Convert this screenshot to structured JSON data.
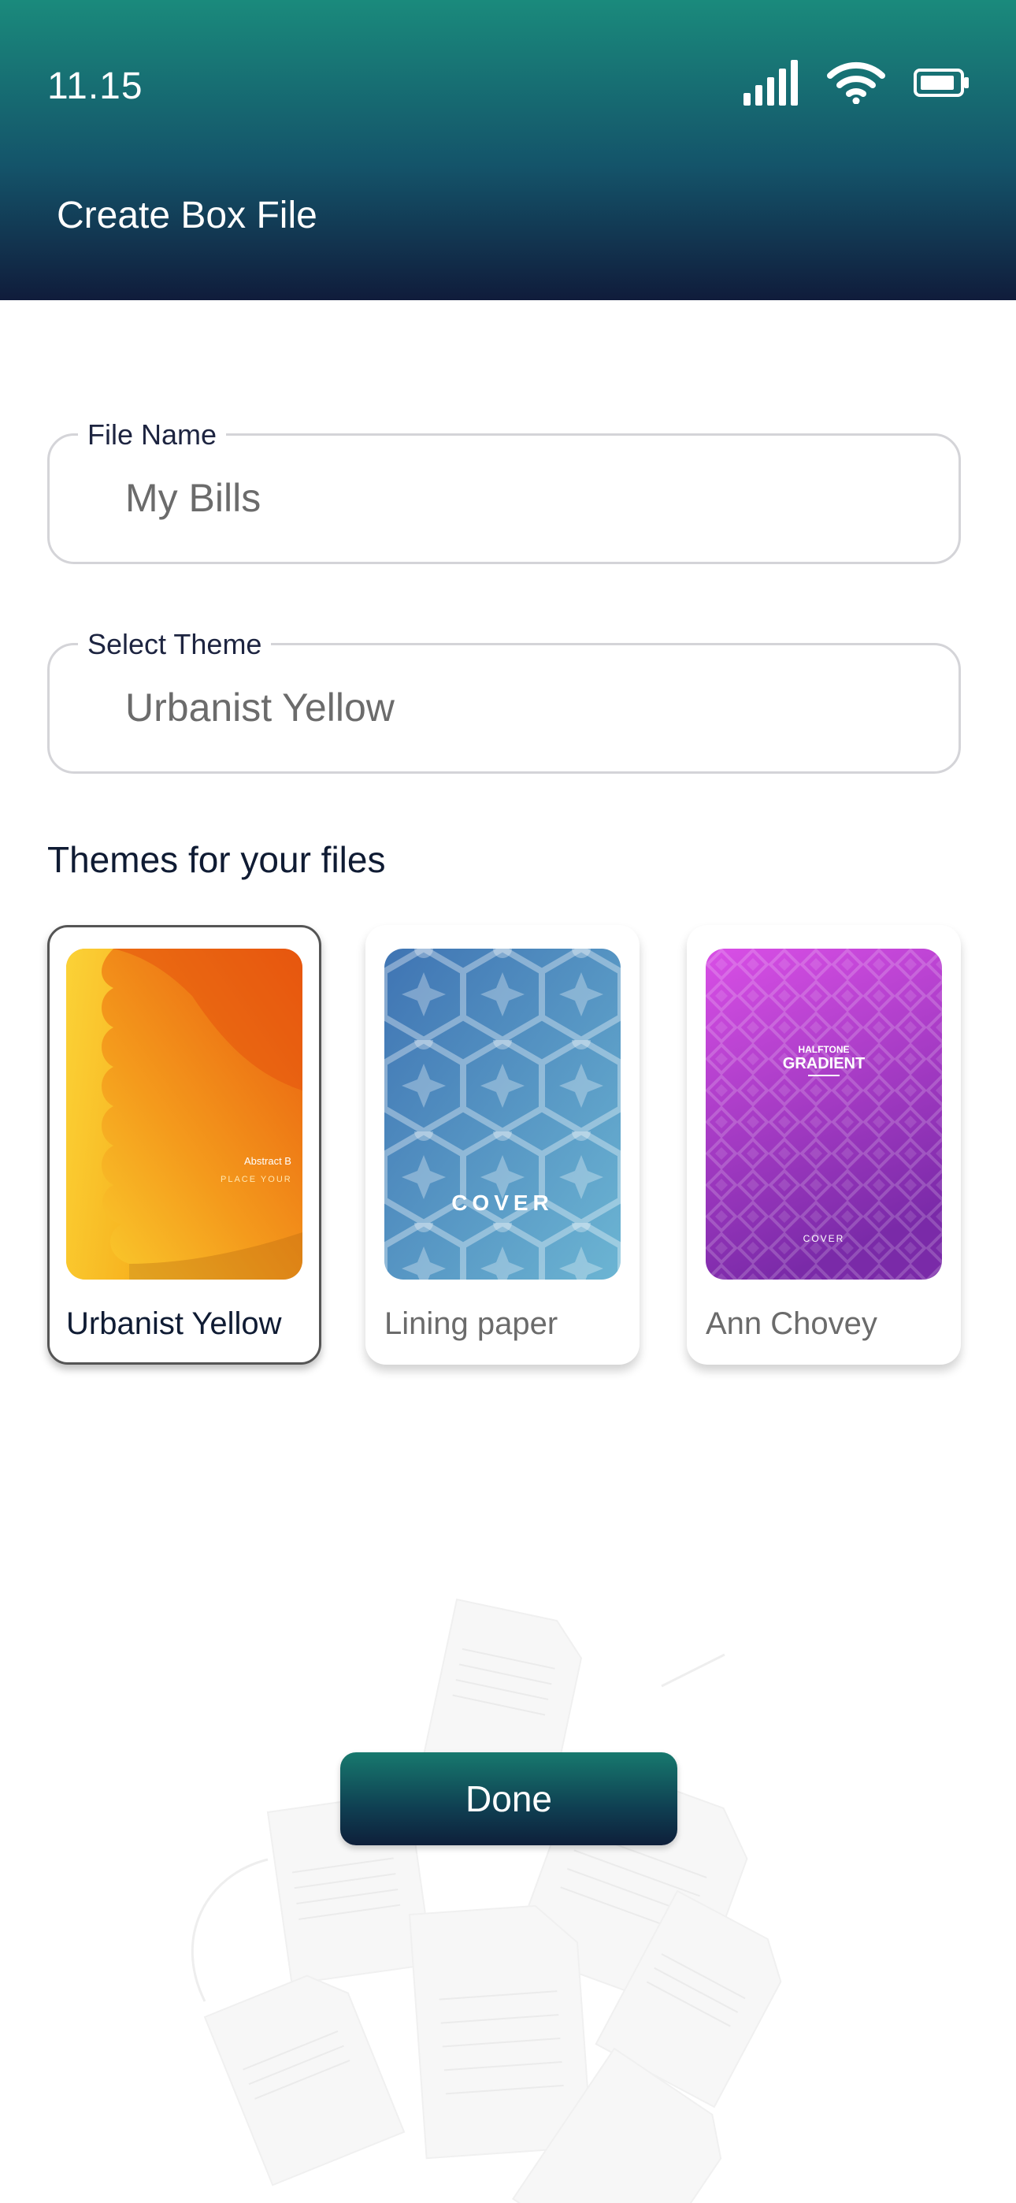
{
  "status_bar": {
    "time": "11.15"
  },
  "header": {
    "title": "Create Box File"
  },
  "file_name": {
    "label": "File Name",
    "value": "My Bills"
  },
  "select_theme": {
    "label": "Select Theme",
    "value": "Urbanist Yellow"
  },
  "themes": {
    "title": "Themes for your files",
    "items": [
      {
        "label": "Urbanist Yellow",
        "selected": true,
        "cover_text": "Abstract B",
        "cover_subtext": "PLACE YOUR"
      },
      {
        "label": "Lining paper",
        "selected": false,
        "cover_text": "COVER"
      },
      {
        "label": "Ann Chovey",
        "selected": false,
        "cover_text_top": "HALFTONE",
        "cover_text_main": "GRADIENT",
        "cover_text_bottom": "COVER"
      }
    ]
  },
  "done_button": {
    "label": "Done"
  },
  "colors": {
    "header_top": "#1a8a7c",
    "header_bottom": "#101c3b",
    "accent": "#17796e"
  }
}
